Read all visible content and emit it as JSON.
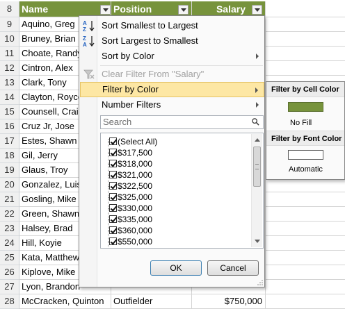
{
  "sheet": {
    "header_row": "8",
    "columns": [
      "Name",
      "Position",
      "Salary"
    ],
    "rows": [
      {
        "num": "9",
        "name": "Aquino, Greg",
        "position": "",
        "salary": ""
      },
      {
        "num": "10",
        "name": "Bruney, Brian",
        "position": "",
        "salary": ""
      },
      {
        "num": "11",
        "name": "Choate, Randy",
        "position": "",
        "salary": ""
      },
      {
        "num": "12",
        "name": "Cintron, Alex",
        "position": "",
        "salary": ""
      },
      {
        "num": "13",
        "name": "Clark, Tony",
        "position": "",
        "salary": ""
      },
      {
        "num": "14",
        "name": "Clayton, Royce",
        "position": "",
        "salary": ""
      },
      {
        "num": "15",
        "name": "Counsell, Craig",
        "position": "",
        "salary": ""
      },
      {
        "num": "16",
        "name": "Cruz Jr, Jose",
        "position": "",
        "salary": ""
      },
      {
        "num": "17",
        "name": "Estes, Shawn",
        "position": "",
        "salary": ""
      },
      {
        "num": "18",
        "name": "Gil, Jerry",
        "position": "",
        "salary": ""
      },
      {
        "num": "19",
        "name": "Glaus, Troy",
        "position": "",
        "salary": ""
      },
      {
        "num": "20",
        "name": "Gonzalez, Luis",
        "position": "",
        "salary": ""
      },
      {
        "num": "21",
        "name": "Gosling, Mike",
        "position": "",
        "salary": ""
      },
      {
        "num": "22",
        "name": "Green, Shawn",
        "position": "",
        "salary": ""
      },
      {
        "num": "23",
        "name": "Halsey, Brad",
        "position": "",
        "salary": ""
      },
      {
        "num": "24",
        "name": "Hill, Koyie",
        "position": "",
        "salary": ""
      },
      {
        "num": "25",
        "name": "Kata, Matthew",
        "position": "",
        "salary": ""
      },
      {
        "num": "26",
        "name": "Kiplove, Mike",
        "position": "",
        "salary": ""
      },
      {
        "num": "27",
        "name": "Lyon, Brandon",
        "position": "",
        "salary": ""
      },
      {
        "num": "28",
        "name": "McCracken, Quinton",
        "position": "Outfielder",
        "salary": "$750,000"
      }
    ],
    "header_color": "#77933c"
  },
  "filter_menu": {
    "sort_asc": "Sort Smallest to Largest",
    "sort_desc": "Sort Largest to Smallest",
    "sort_by_color": "Sort by Color",
    "clear_filter": "Clear Filter From \"Salary\"",
    "filter_by_color": "Filter by Color",
    "number_filters": "Number Filters",
    "search_placeholder": "Search",
    "values": [
      "(Select All)",
      "$317,500",
      "$318,000",
      "$321,000",
      "$322,500",
      "$325,000",
      "$330,000",
      "$335,000",
      "$360,000",
      "$550,000"
    ],
    "ok": "OK",
    "cancel": "Cancel",
    "highlight_color": "#fde7a4"
  },
  "color_submenu": {
    "cell_color_header": "Filter by Cell Color",
    "no_fill": "No Fill",
    "font_color_header": "Filter by Font Color",
    "automatic": "Automatic",
    "cell_swatch": "#77933c"
  }
}
